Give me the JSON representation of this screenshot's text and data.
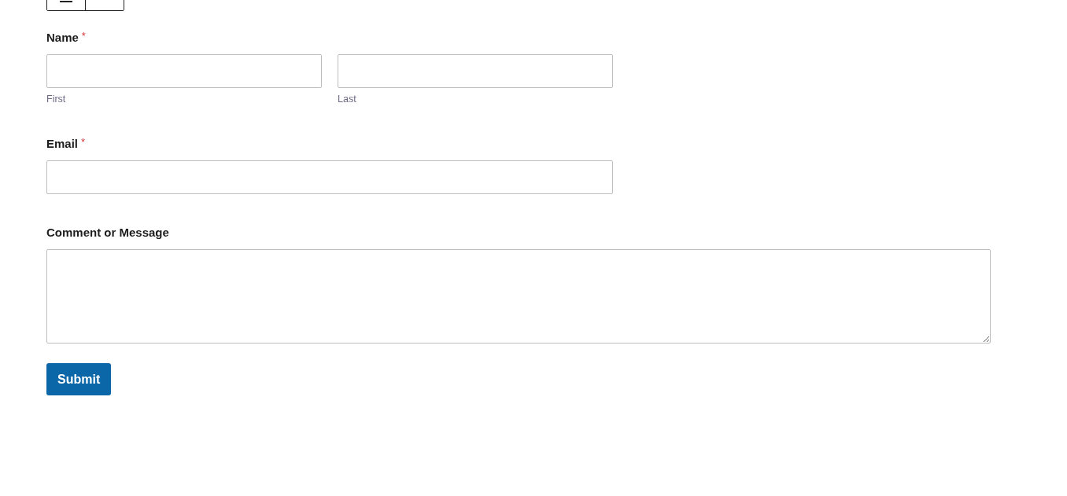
{
  "top_toolbar": {
    "buttons": [
      {
        "kind": "icon"
      },
      {
        "kind": "empty"
      }
    ]
  },
  "fields": [
    {
      "kind": "name",
      "label": "Name",
      "required_mark": "*",
      "parts": [
        {
          "sublabel": "First"
        },
        {
          "sublabel": "Last"
        }
      ]
    },
    {
      "kind": "text",
      "label": "Email",
      "required_mark": "*"
    },
    {
      "kind": "textarea",
      "label": "Comment or Message"
    }
  ],
  "submit": {
    "label": "Submit"
  }
}
